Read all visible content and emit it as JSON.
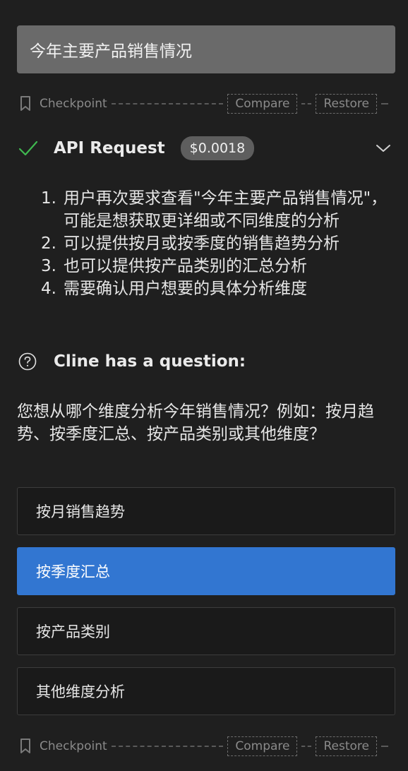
{
  "user_message": "今年主要产品销售情况",
  "checkpoint": {
    "label": "Checkpoint",
    "compare_label": "Compare",
    "restore_label": "Restore"
  },
  "api_request": {
    "title": "API Request",
    "cost": "$0.0018"
  },
  "steps": [
    {
      "num": "1.",
      "text": "用户再次要求查看\"今年主要产品销售情况\"，可能是想获取更详细或不同维度的分析"
    },
    {
      "num": "2.",
      "text": "可以提供按月或按季度的销售趋势分析"
    },
    {
      "num": "3.",
      "text": "也可以提供按产品类别的汇总分析"
    },
    {
      "num": "4.",
      "text": "需要确认用户想要的具体分析维度"
    }
  ],
  "question": {
    "title": "Cline has a question:",
    "text": "您想从哪个维度分析今年销售情况？例如：按月趋势、按季度汇总、按产品类别或其他维度？"
  },
  "options": [
    {
      "label": "按月销售趋势",
      "selected": false
    },
    {
      "label": "按季度汇总",
      "selected": true
    },
    {
      "label": "按产品类别",
      "selected": false
    },
    {
      "label": "其他维度分析",
      "selected": false
    }
  ],
  "colors": {
    "background": "#1f1f1f",
    "selected_option": "#3276d1",
    "check_green": "#3fb950"
  },
  "icons": [
    "bookmark-icon",
    "check-icon",
    "chevron-down-icon",
    "question-circle-icon"
  ]
}
